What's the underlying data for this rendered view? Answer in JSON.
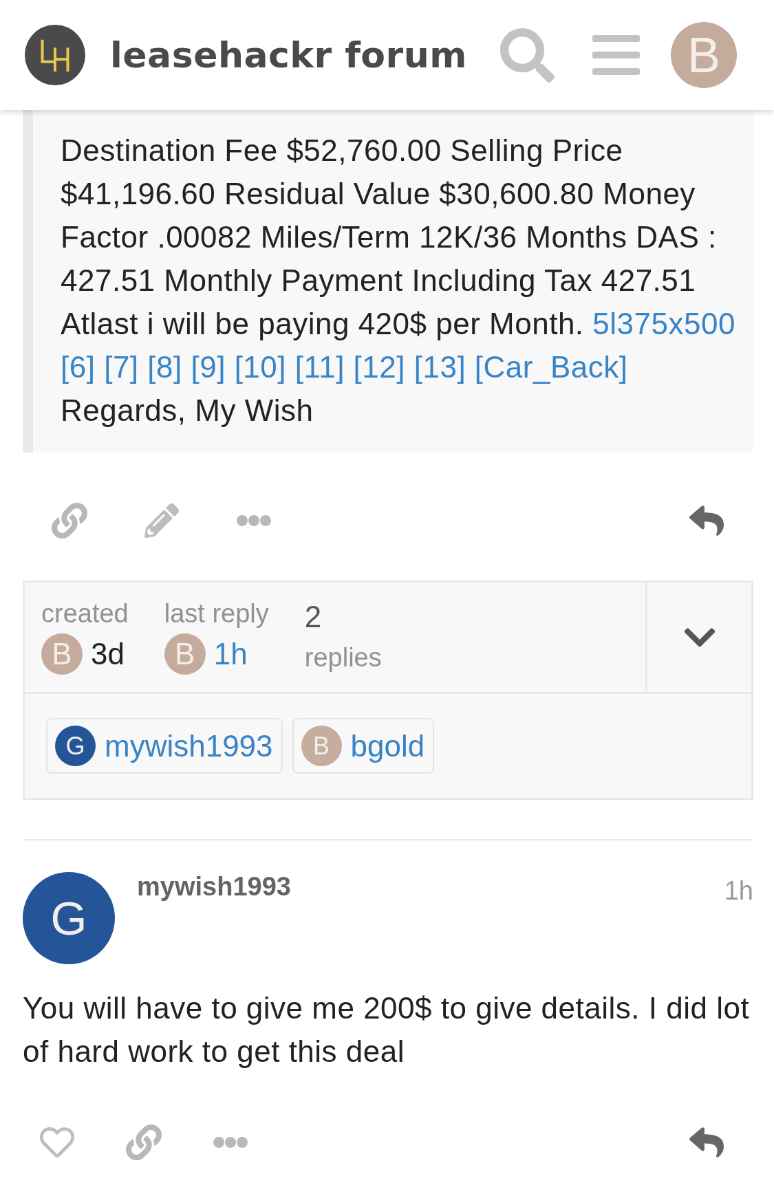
{
  "header": {
    "title": "leasehackr forum",
    "avatar": "B"
  },
  "quote": {
    "text": "Destination Fee $52,760.00 Selling Price $41,196.60 Residual Value $30,600.80 Money Factor .00082 Miles/Term 12K/36 Months DAS : 427.51 Monthly Payment Including Tax 427.51 Atlast i will be paying 420$ per Month.",
    "links": [
      "5l375x500",
      "[6]",
      "[7]",
      "[8]",
      "[9]",
      "[10]",
      "[11]",
      "[12]",
      "[13]",
      "[Car_Back]"
    ],
    "signature": "Regards, My Wish"
  },
  "post_actions": [
    {
      "kind": "link"
    },
    {
      "kind": "edit"
    },
    {
      "kind": "more"
    },
    {
      "kind": "reply"
    }
  ],
  "topic_map": {
    "expanded": false,
    "created": {
      "label": "created",
      "avatar": "B",
      "time": "3d"
    },
    "last_reply": {
      "label": "last reply",
      "avatar": "B",
      "time": "1h"
    },
    "replies": {
      "count": "2",
      "label": "replies"
    },
    "participants": [
      {
        "avatar": "G",
        "name": "mywish1993",
        "color": "#235598"
      },
      {
        "avatar": "B",
        "name": "bgold",
        "color": "#c6ae9f"
      }
    ]
  },
  "post": {
    "avatar": "G",
    "author": "mywish1993",
    "time": "1h",
    "body": "You will have to give me 200$ to give details. I did lot of hard work to get this deal",
    "actions": [
      {
        "kind": "like"
      },
      {
        "kind": "link"
      },
      {
        "kind": "more"
      },
      {
        "kind": "reply"
      }
    ]
  }
}
